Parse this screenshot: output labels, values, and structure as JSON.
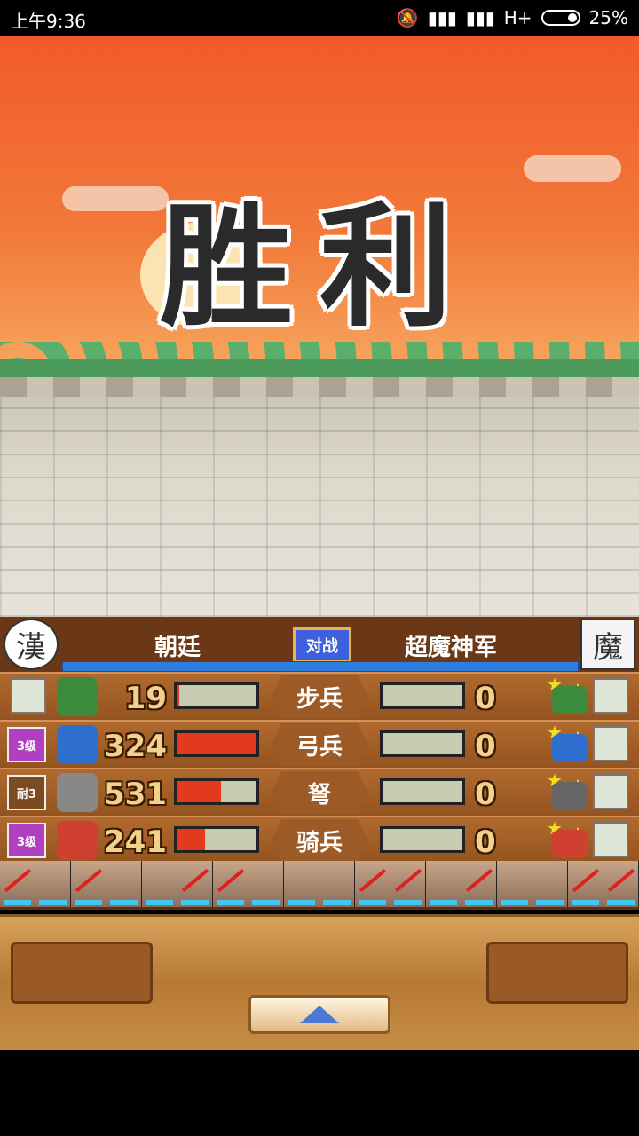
{
  "status": {
    "time": "上午9:36",
    "network": "H+",
    "battery": "25%"
  },
  "banner": {
    "text": "胜利"
  },
  "header": {
    "left_emblem": "漢",
    "left_name": "朝廷",
    "vs": "对战",
    "right_name": "超魔神军",
    "right_emblem": "魔"
  },
  "rows": [
    {
      "badge": "",
      "count": "19",
      "hp": 0.03,
      "type": "步兵",
      "enemy_count": "0",
      "enemy_hp": 0
    },
    {
      "badge": "3级",
      "count": "324",
      "hp": 1.0,
      "type": "弓兵",
      "enemy_count": "0",
      "enemy_hp": 0
    },
    {
      "badge": "耐3",
      "count": "531",
      "hp": 0.55,
      "type": "弩",
      "enemy_count": "0",
      "enemy_hp": 0
    },
    {
      "badge": "3级",
      "count": "241",
      "hp": 0.35,
      "type": "骑兵",
      "enemy_count": "0",
      "enemy_hp": 0
    }
  ]
}
